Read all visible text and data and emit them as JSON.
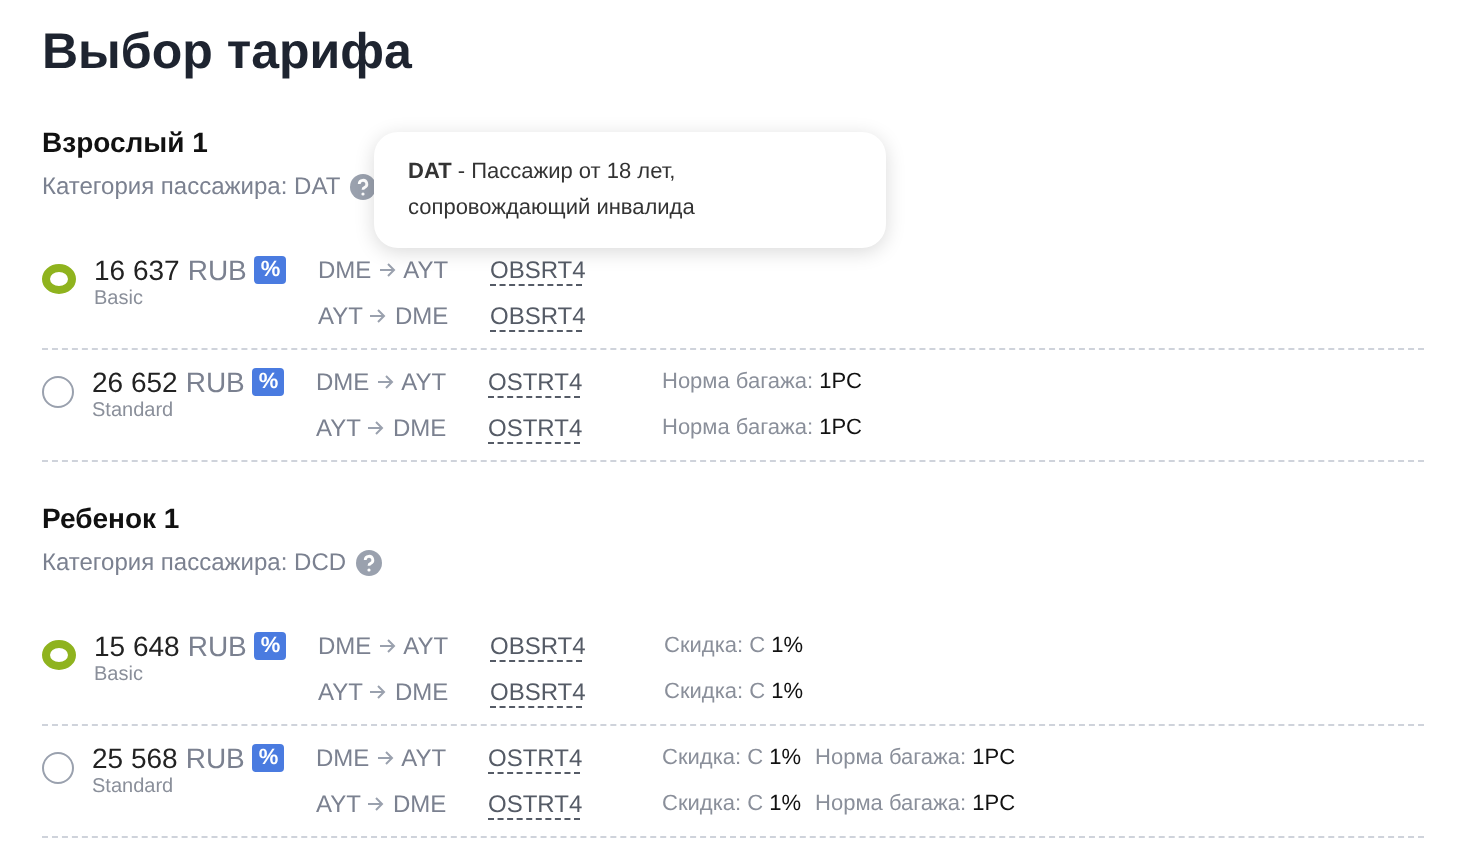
{
  "title": "Выбор тарифа",
  "tooltip": {
    "code": "DAT",
    "text": " - Пассажир от 18 лет, сопровождающий инвалида"
  },
  "passengers": [
    {
      "name": "Взрослый 1",
      "category_label": "Категория пассажира:",
      "category": "DAT",
      "fares": [
        {
          "selected": true,
          "price": "16 637",
          "currency": "RUB",
          "discount_badge": "%",
          "fare_class": "Basic",
          "segments": [
            {
              "from": "DME",
              "to": "AYT",
              "code": "OBSRT4"
            },
            {
              "from": "AYT",
              "to": "DME",
              "code": "OBSRT4"
            }
          ]
        },
        {
          "selected": false,
          "price": "26 652",
          "currency": "RUB",
          "discount_badge": "%",
          "fare_class": "Standard",
          "segments": [
            {
              "from": "DME",
              "to": "AYT",
              "code": "OSTRT4",
              "extras": [
                {
                  "label": "Норма багажа:",
                  "value": "1PC"
                }
              ]
            },
            {
              "from": "AYT",
              "to": "DME",
              "code": "OSTRT4",
              "extras": [
                {
                  "label": "Норма багажа:",
                  "value": "1PC"
                }
              ]
            }
          ]
        }
      ]
    },
    {
      "name": "Ребенок 1",
      "category_label": "Категория пассажира:",
      "category": "DCD",
      "fares": [
        {
          "selected": true,
          "price": "15 648",
          "currency": "RUB",
          "discount_badge": "%",
          "fare_class": "Basic",
          "segments": [
            {
              "from": "DME",
              "to": "AYT",
              "code": "OBSRT4",
              "extras": [
                {
                  "label": "Скидка: С",
                  "value": "1%"
                }
              ]
            },
            {
              "from": "AYT",
              "to": "DME",
              "code": "OBSRT4",
              "extras": [
                {
                  "label": "Скидка: С",
                  "value": "1%"
                }
              ]
            }
          ]
        },
        {
          "selected": false,
          "price": "25 568",
          "currency": "RUB",
          "discount_badge": "%",
          "fare_class": "Standard",
          "segments": [
            {
              "from": "DME",
              "to": "AYT",
              "code": "OSTRT4",
              "extras": [
                {
                  "label": "Скидка: С",
                  "value": "1%"
                },
                {
                  "label": "Норма багажа:",
                  "value": "1PC"
                }
              ]
            },
            {
              "from": "AYT",
              "to": "DME",
              "code": "OSTRT4",
              "extras": [
                {
                  "label": "Скидка: С",
                  "value": "1%"
                },
                {
                  "label": "Норма багажа:",
                  "value": "1PC"
                }
              ]
            }
          ]
        }
      ]
    }
  ]
}
